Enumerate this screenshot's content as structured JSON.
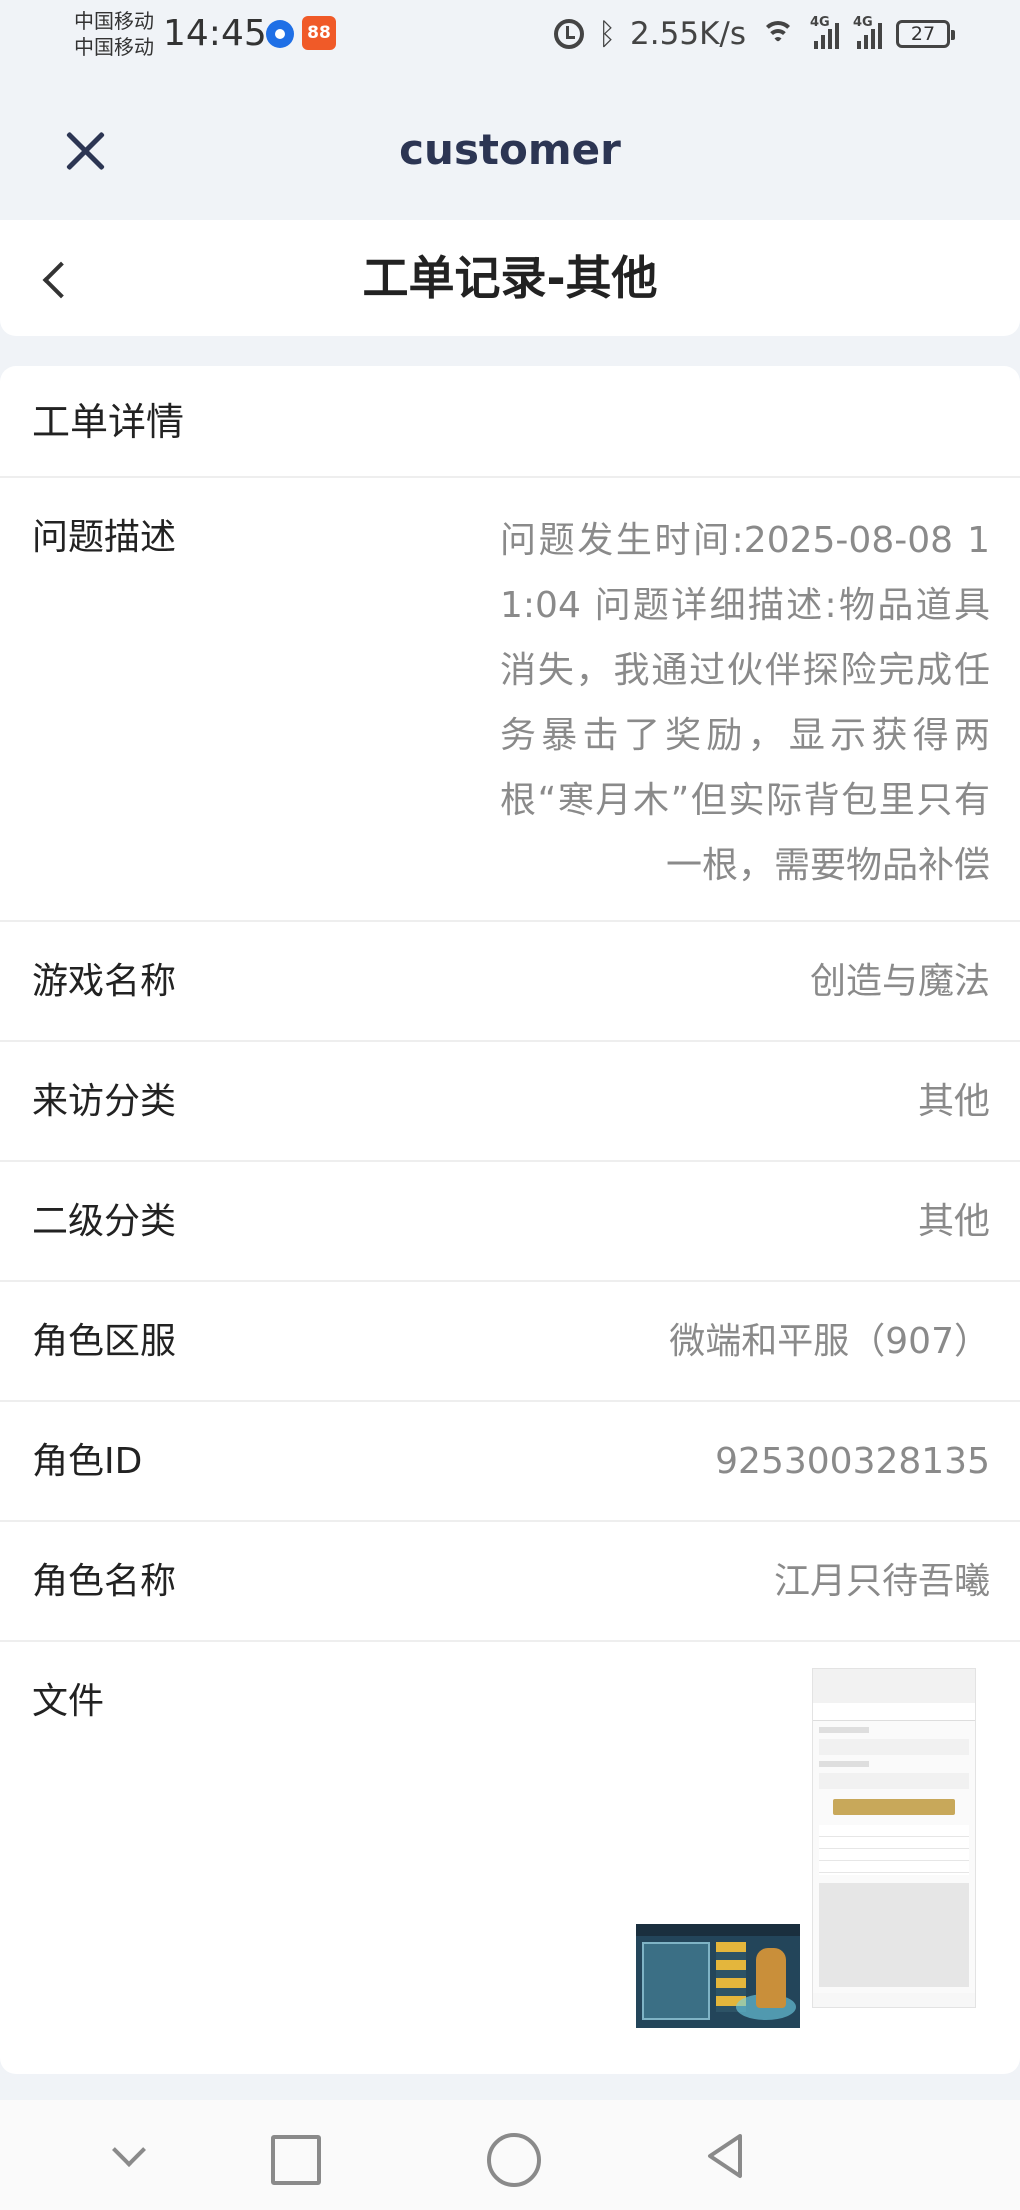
{
  "status_bar": {
    "carrier_line1": "中国移动",
    "carrier_line2": "中国移动",
    "time": "14:45",
    "notification_app_badge": "88",
    "network_speed": "2.55K/s",
    "signal_type_1": "4G",
    "signal_type_2": "4G",
    "battery_level": "27"
  },
  "webview": {
    "title": "customer"
  },
  "header": {
    "title": "工单记录-其他"
  },
  "detail": {
    "heading": "工单详情",
    "rows": [
      {
        "label": "问题描述",
        "value": "问题发生时间:2025-08-08 11:04 问题详细描述:物品道具消失，我通过伙伴探险完成任务暴击了奖励，显示获得两根“寒月木”但实际背包里只有一根，需要物品补偿"
      },
      {
        "label": "游戏名称",
        "value": "创造与魔法"
      },
      {
        "label": "来访分类",
        "value": "其他"
      },
      {
        "label": "二级分类",
        "value": "其他"
      },
      {
        "label": "角色区服",
        "value": "微端和平服（907）"
      },
      {
        "label": "角色ID",
        "value": "925300328135"
      },
      {
        "label": "角色名称",
        "value": "江月只待吾曦"
      }
    ],
    "file_label": "文件"
  }
}
